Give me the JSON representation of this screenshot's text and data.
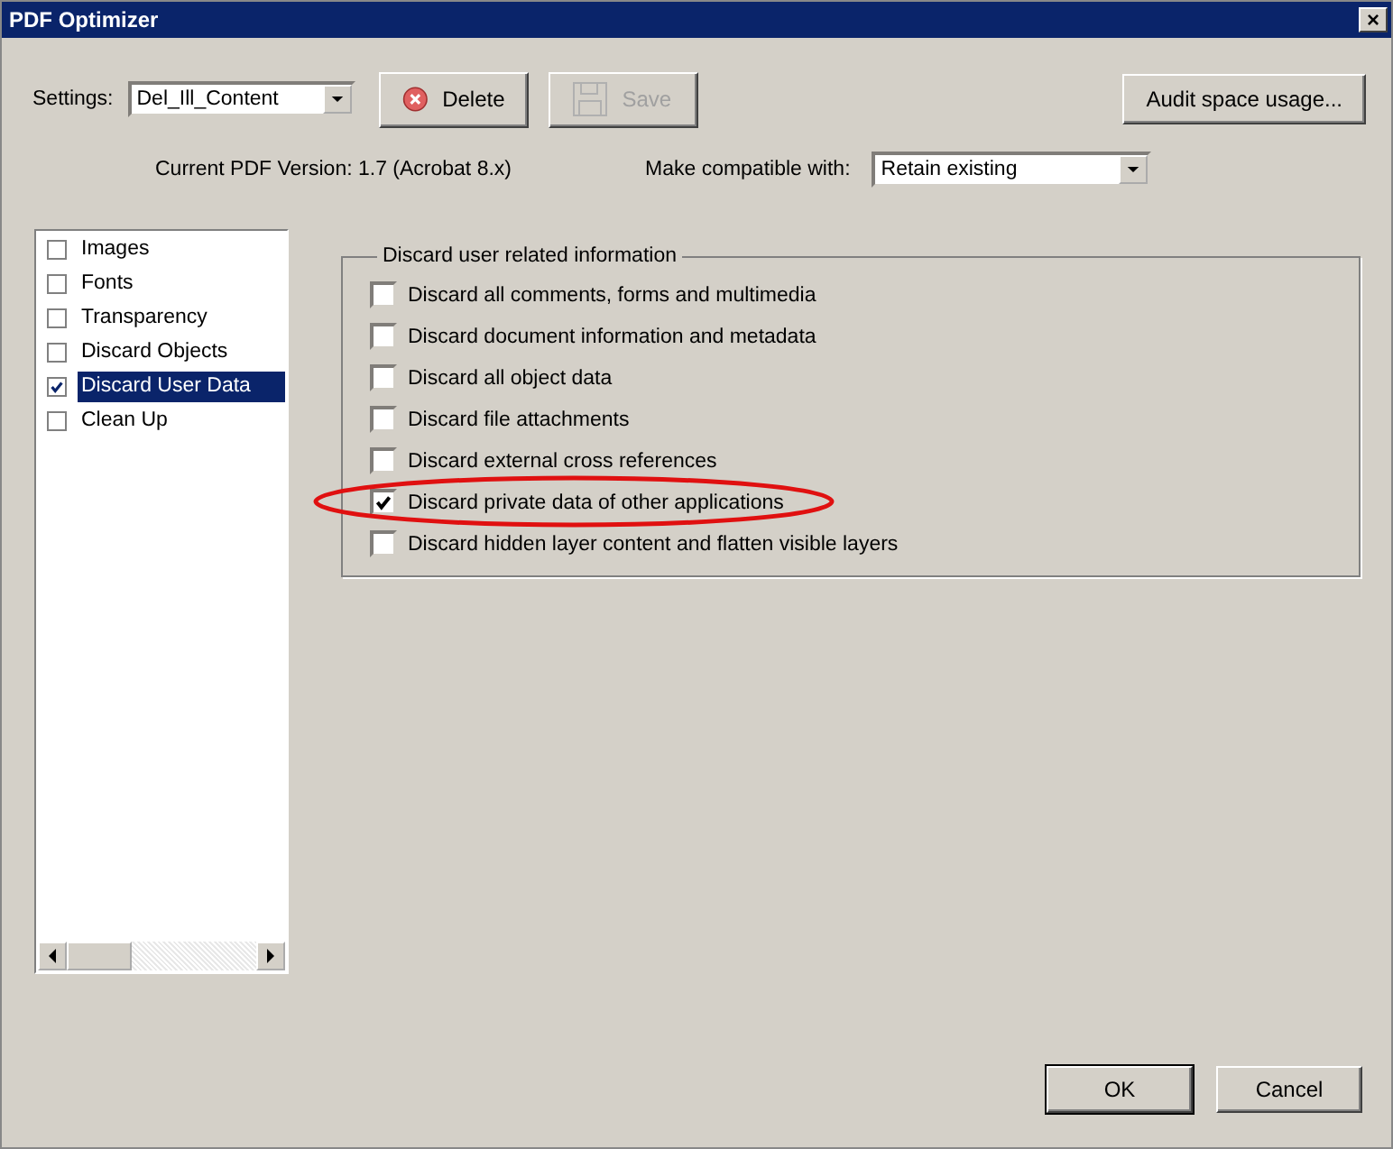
{
  "window": {
    "title": "PDF Optimizer",
    "close": "×"
  },
  "settings": {
    "label": "Settings:",
    "value": "Del_Ill_Content"
  },
  "toolbar_buttons": [
    {
      "kind": "delete",
      "label": "Delete",
      "disabled": false
    },
    {
      "kind": "save",
      "label": "Save",
      "disabled": true
    }
  ],
  "audit_button": "Audit space usage...",
  "version": "Current PDF Version: 1.7 (Acrobat 8.x)",
  "compatible": {
    "label": "Make compatible with:",
    "value": "Retain existing"
  },
  "categories": [
    {
      "label": "Images",
      "checked": false,
      "selected": false
    },
    {
      "label": "Fonts",
      "checked": false,
      "selected": false
    },
    {
      "label": "Transparency",
      "checked": false,
      "selected": false
    },
    {
      "label": "Discard Objects",
      "checked": false,
      "selected": false
    },
    {
      "label": "Discard User Data",
      "checked": true,
      "selected": true
    },
    {
      "label": "Clean Up",
      "checked": false,
      "selected": false
    }
  ],
  "group": {
    "title": "Discard user related information",
    "options": [
      {
        "label": "Discard all comments, forms and multimedia",
        "checked": false,
        "highlighted": false
      },
      {
        "label": "Discard document information and metadata",
        "checked": false,
        "highlighted": false
      },
      {
        "label": "Discard all object data",
        "checked": false,
        "highlighted": false
      },
      {
        "label": "Discard file attachments",
        "checked": false,
        "highlighted": false
      },
      {
        "label": "Discard external cross references",
        "checked": false,
        "highlighted": false
      },
      {
        "label": "Discard private data of other applications",
        "checked": true,
        "highlighted": true
      },
      {
        "label": "Discard hidden layer content and flatten visible layers",
        "checked": false,
        "highlighted": false
      }
    ]
  },
  "buttons": [
    {
      "label": "OK",
      "default": true
    },
    {
      "label": "Cancel",
      "default": false
    }
  ]
}
